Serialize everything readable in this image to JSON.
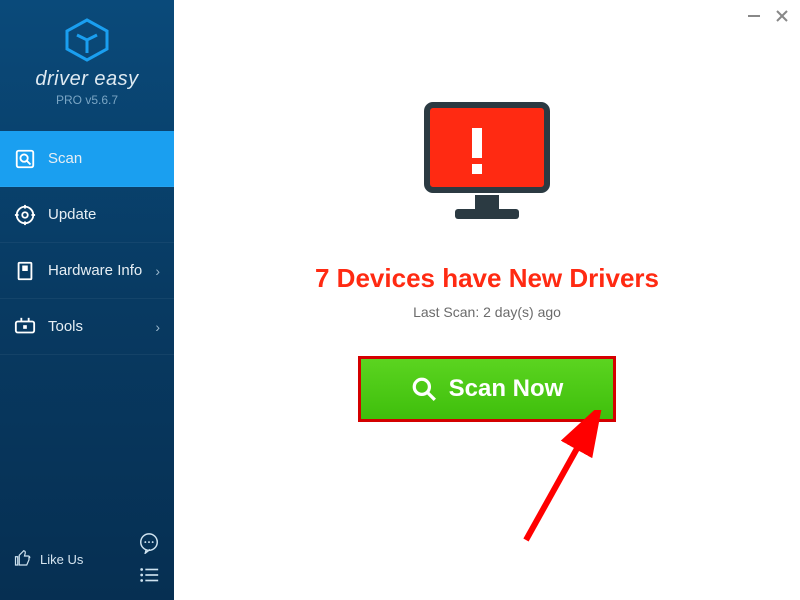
{
  "app": {
    "name": "driver easy",
    "version": "PRO v5.6.7"
  },
  "sidebar": {
    "items": [
      {
        "label": "Scan",
        "icon": "scan-icon",
        "active": true,
        "chevron": false
      },
      {
        "label": "Update",
        "icon": "update-icon",
        "active": false,
        "chevron": false
      },
      {
        "label": "Hardware Info",
        "icon": "hardware-icon",
        "active": false,
        "chevron": true
      },
      {
        "label": "Tools",
        "icon": "tools-icon",
        "active": false,
        "chevron": true
      }
    ],
    "footer": {
      "like_label": "Like Us"
    }
  },
  "main": {
    "headline": "7 Devices have New Drivers",
    "subline": "Last Scan: 2 day(s) ago",
    "scan_button_label": "Scan Now"
  },
  "colors": {
    "accent_red": "#ff2a12",
    "scan_green": "#3fbf0c",
    "sidebar_active": "#1a9ff0"
  }
}
